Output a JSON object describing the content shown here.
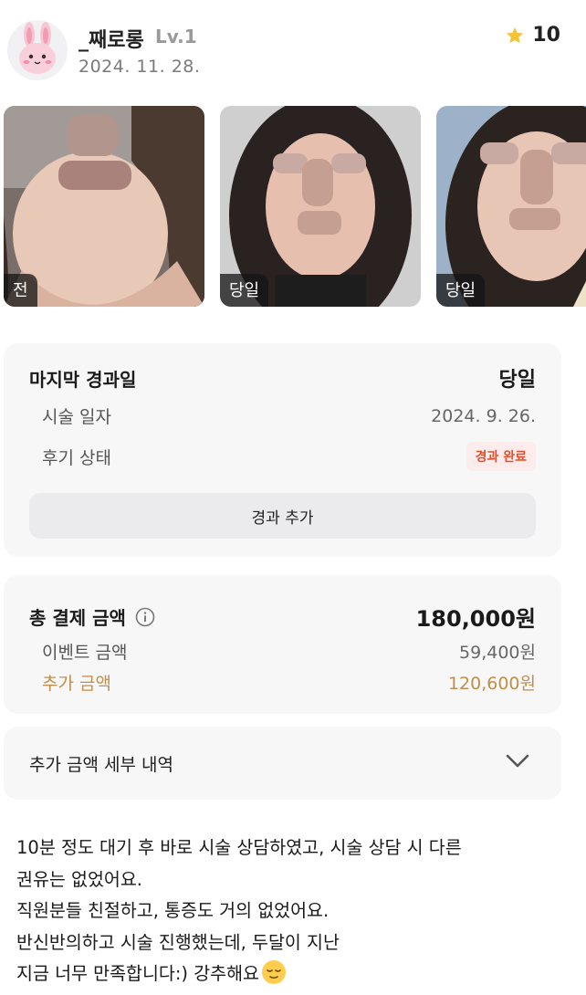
{
  "author": {
    "name": "_째로롱",
    "level": "Lv.1",
    "date": "2024. 11. 28.",
    "avatar_icon": "bunny-avatar-icon"
  },
  "rating": {
    "icon": "star-icon",
    "value": "10",
    "color": "#f5c334"
  },
  "photos": [
    {
      "label": "전"
    },
    {
      "label": "당일"
    },
    {
      "label": "당일"
    }
  ],
  "result": {
    "title": "마지막 경과일",
    "value": "당일",
    "procedure_date_label": "시술 일자",
    "procedure_date": "2024. 9. 26.",
    "status_label": "후기 상태",
    "status_badge": "경과 완료",
    "add_button": "경과 추가"
  },
  "payment": {
    "total_label": "총 결제 금액",
    "total_icon": "info-icon",
    "total_value": "180,000원",
    "event_label": "이벤트 금액",
    "event_value": "59,400원",
    "extra_label": "추가 금액",
    "extra_value": "120,600원",
    "accent_color": "#c18e4b"
  },
  "detail": {
    "label": "추가 금액 세부 내역",
    "icon": "chevron-down-icon"
  },
  "review": {
    "lines": [
      "10분 정도 대기 후 바로 시술 상담하였고, 시술 상담 시 다른",
      "권유는 없었어요.",
      "직원분들 친절하고, 통증도 거의 없었어요.",
      "반신반의하고 시술 진행했는데, 두달이 지난",
      "지금 너무 만족합니다:) 강추해요"
    ],
    "emoji": "relieved-face-emoji"
  }
}
